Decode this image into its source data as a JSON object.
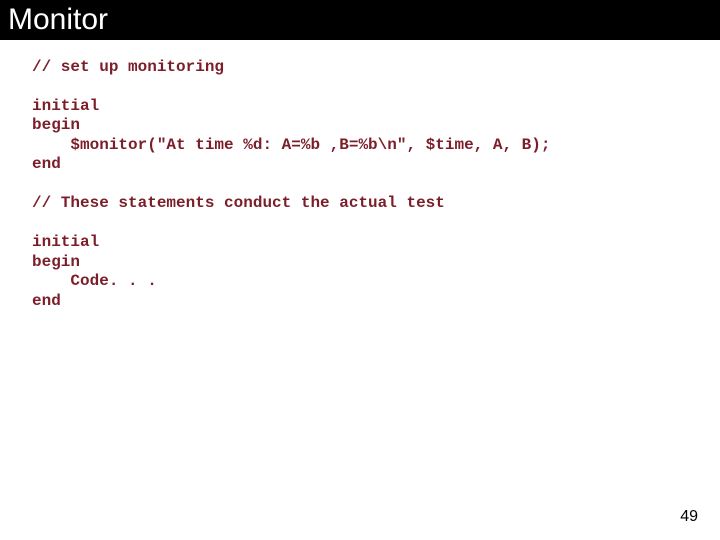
{
  "title": "Monitor",
  "code": "// set up monitoring\n\ninitial\nbegin\n    $monitor(\"At time %d: A=%b ,B=%b\\n\", $time, A, B);\nend\n\n// These statements conduct the actual test\n\ninitial\nbegin\n    Code. . .\nend",
  "page_number": "49"
}
